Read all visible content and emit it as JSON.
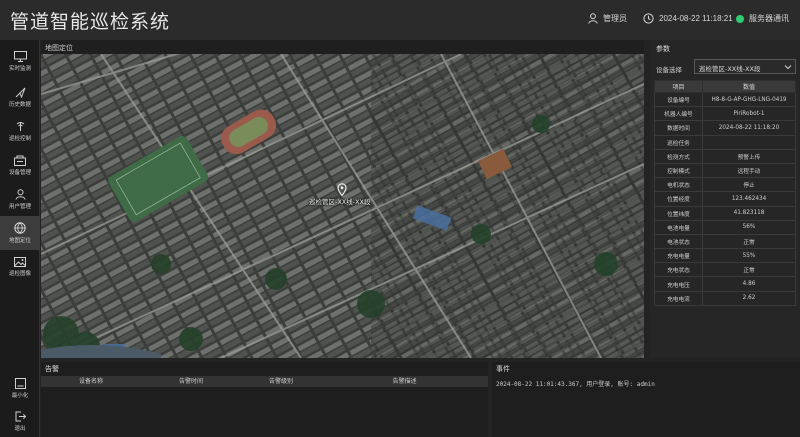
{
  "app": {
    "title": "管道智能巡检系统"
  },
  "header": {
    "user": "管理员",
    "datetime": "2024-08-22 11:18:21",
    "server_status": "服务器通讯",
    "server_status_color": "#2ecc71"
  },
  "sidebar": {
    "items": [
      {
        "label": "实时监测",
        "icon": "monitor-icon"
      },
      {
        "label": "历史数据",
        "icon": "history-icon"
      },
      {
        "label": "巡检控制",
        "icon": "control-icon"
      },
      {
        "label": "设备管理",
        "icon": "device-icon"
      },
      {
        "label": "用户管理",
        "icon": "user-icon"
      },
      {
        "label": "地图定位",
        "icon": "map-icon",
        "active": true
      },
      {
        "label": "巡检图像",
        "icon": "image-icon"
      }
    ],
    "minimize_label": "最小化",
    "logout_label": "退出"
  },
  "map": {
    "title": "地图定位",
    "pin_label": "巡检管区-XX线-XX段"
  },
  "params": {
    "title": "参数",
    "device_select_label": "设备选择",
    "device_select_value": "巡检管区-XX线-XX段",
    "col_item": "项目",
    "col_value": "数值",
    "rows": [
      {
        "k": "设备编号",
        "v": "H8-8-G-AP-GHG-LNG-0419"
      },
      {
        "k": "机器人编号",
        "v": "PiriRobot-1"
      },
      {
        "k": "数据时间",
        "v": "2024-08-22 11:18:20"
      },
      {
        "k": "巡检任务",
        "v": ""
      },
      {
        "k": "检测方式",
        "v": "预警上传"
      },
      {
        "k": "控制模式",
        "v": "远程手动"
      },
      {
        "k": "电机状态",
        "v": "停止"
      },
      {
        "k": "位置经度",
        "v": "123.462434"
      },
      {
        "k": "位置纬度",
        "v": "41.823118"
      },
      {
        "k": "电池电量",
        "v": "56%"
      },
      {
        "k": "电池状态",
        "v": "正常"
      },
      {
        "k": "充电电量",
        "v": "55%"
      },
      {
        "k": "充电状态",
        "v": "正常"
      },
      {
        "k": "充电电压",
        "v": "4.86"
      },
      {
        "k": "充电电流",
        "v": "2.62"
      }
    ]
  },
  "alarm": {
    "title": "告警",
    "columns": [
      "设备名称",
      "告警时间",
      "告警级别",
      "告警描述"
    ]
  },
  "events": {
    "title": "事件",
    "lines": [
      "2024-08-22 11:01:43.367, 用户登录, 账号: admin"
    ]
  }
}
